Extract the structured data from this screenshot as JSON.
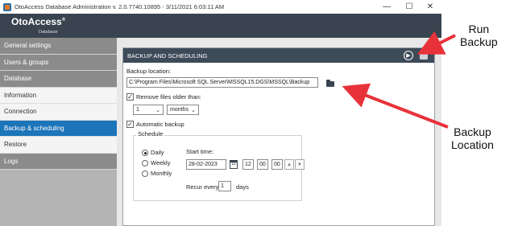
{
  "window": {
    "title": "OtoAccess Database Administration v. 2.0.7740.10895  -  3/11/2021 6:03:11 AM",
    "minimize_glyph": "—",
    "maximize_glyph": "☐",
    "close_glyph": "✕"
  },
  "brand": {
    "logo_text": "OtoAccess",
    "logo_mark": "®",
    "logo_sub": "Database"
  },
  "sidebar": {
    "items": [
      {
        "label": "General settings"
      },
      {
        "label": "Users & groups"
      },
      {
        "label": "Database"
      },
      {
        "label": "Information"
      },
      {
        "label": "Connection"
      },
      {
        "label": "Backup & scheduling"
      },
      {
        "label": "Restore"
      },
      {
        "label": "Logs"
      }
    ]
  },
  "panel": {
    "title": "BACKUP AND SCHEDULING",
    "run_icon": "run-backup-icon",
    "save_icon": "save-icon",
    "backup_location_label": "Backup location:",
    "backup_location_value": "C:\\Program Files\\Microsoft SQL Server\\MSSQL15.DGS\\MSSQL\\Backup",
    "remove_files_label": "Remove files older than:",
    "remove_files_checked": true,
    "remove_amount": "1",
    "remove_unit": "months",
    "automatic_backup_label": "Automatic backup",
    "automatic_backup_checked": true,
    "schedule_label": "Schedule",
    "frequency_options": [
      "Daily",
      "Weekly",
      "Monthly"
    ],
    "frequency_selected": "Daily",
    "start_time_label": "Start time:",
    "start_date": "28-02-2023",
    "calendar_glyph": "15",
    "hour": "12",
    "minute": "00",
    "second": "00",
    "recur_label": "Recur every:",
    "recur_value": "1",
    "recur_unit": "days",
    "checkmark": "✓",
    "dropdown_glyph": "⌄",
    "spin_up": "▲",
    "spin_down": "▼"
  },
  "annotations": {
    "run_backup": "Run\nBackup",
    "backup_location": "Backup\nLocation",
    "arrow_color": "#e8323a"
  }
}
